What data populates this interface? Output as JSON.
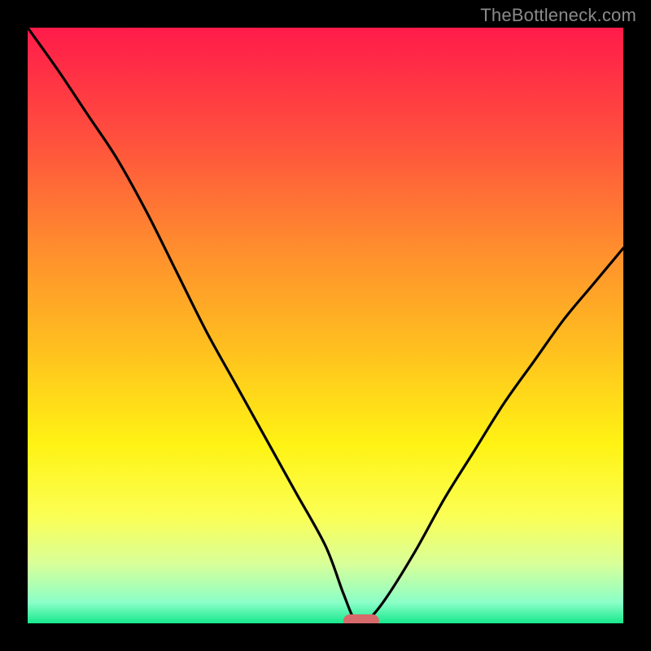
{
  "watermark": "TheBottleneck.com",
  "colors": {
    "gradient_stops": [
      {
        "offset": 0.0,
        "color": "#ff1b4a"
      },
      {
        "offset": 0.18,
        "color": "#ff4e3e"
      },
      {
        "offset": 0.36,
        "color": "#ff8a2f"
      },
      {
        "offset": 0.54,
        "color": "#ffc01f"
      },
      {
        "offset": 0.7,
        "color": "#fff314"
      },
      {
        "offset": 0.82,
        "color": "#fbff55"
      },
      {
        "offset": 0.9,
        "color": "#d9ff99"
      },
      {
        "offset": 0.965,
        "color": "#8bffc8"
      },
      {
        "offset": 1.0,
        "color": "#17e88c"
      }
    ],
    "frame": "#000000",
    "curve": "#000000",
    "marker": "#d66a6a"
  },
  "chart_data": {
    "type": "line",
    "title": "",
    "xlabel": "",
    "ylabel": "",
    "xlim": [
      0,
      100
    ],
    "ylim": [
      0,
      100
    ],
    "x": [
      0,
      5,
      10,
      15,
      20,
      25,
      30,
      35,
      40,
      45,
      50,
      53,
      55,
      57,
      60,
      65,
      70,
      75,
      80,
      85,
      90,
      95,
      100
    ],
    "values": [
      100,
      93,
      85.5,
      78,
      69,
      59,
      49,
      40,
      31,
      22,
      13,
      5,
      0.5,
      0.5,
      4,
      12,
      21,
      29,
      37,
      44,
      51,
      57,
      63
    ],
    "marker": {
      "x_center": 56,
      "y": 0.4,
      "width": 6,
      "height": 2.2
    },
    "grid": false,
    "legend": false
  }
}
